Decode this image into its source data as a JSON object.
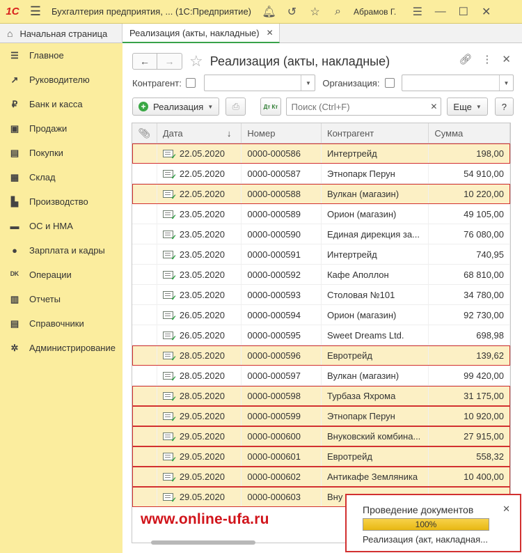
{
  "app": {
    "logo": "1С",
    "title": "Бухгалтерия предприятия, ...  (1С:Предприятие)",
    "user": "Абрамов Г."
  },
  "tabs": {
    "home": "Начальная страница",
    "active": "Реализация (акты, накладные)"
  },
  "sidebar": {
    "items": [
      {
        "label": "Главное",
        "icon": "menu-icon"
      },
      {
        "label": "Руководителю",
        "icon": "chart-line-icon"
      },
      {
        "label": "Банк и касса",
        "icon": "ruble-icon"
      },
      {
        "label": "Продажи",
        "icon": "shopping-bag-icon"
      },
      {
        "label": "Покупки",
        "icon": "cart-icon"
      },
      {
        "label": "Склад",
        "icon": "warehouse-icon"
      },
      {
        "label": "Производство",
        "icon": "factory-icon"
      },
      {
        "label": "ОС и НМА",
        "icon": "truck-icon"
      },
      {
        "label": "Зарплата и кадры",
        "icon": "person-icon"
      },
      {
        "label": "Операции",
        "icon": "dt-kt-icon"
      },
      {
        "label": "Отчеты",
        "icon": "bar-chart-icon"
      },
      {
        "label": "Справочники",
        "icon": "books-icon"
      },
      {
        "label": "Администрирование",
        "icon": "gear-icon"
      }
    ]
  },
  "form": {
    "title": "Реализация (акты, накладные)",
    "filter": {
      "counterparty_label": "Контрагент:",
      "organization_label": "Организация:"
    },
    "toolbar": {
      "create_label": "Реализация",
      "dtkt_label": "Дт Кт",
      "search_placeholder": "Поиск (Ctrl+F)",
      "more_label": "Еще",
      "help_label": "?"
    },
    "columns": [
      "Дата",
      "Номер",
      "Контрагент",
      "Сумма"
    ],
    "rows": [
      {
        "date": "22.05.2020",
        "number": "0000-000586",
        "counterparty": "Интертрейд",
        "sum": "198,00",
        "highlight": true
      },
      {
        "date": "22.05.2020",
        "number": "0000-000587",
        "counterparty": "Этнопарк Перун",
        "sum": "54 910,00",
        "highlight": false
      },
      {
        "date": "22.05.2020",
        "number": "0000-000588",
        "counterparty": "Вулкан (магазин)",
        "sum": "10 220,00",
        "highlight": true
      },
      {
        "date": "23.05.2020",
        "number": "0000-000589",
        "counterparty": "Орион (магазин)",
        "sum": "49 105,00",
        "highlight": false
      },
      {
        "date": "23.05.2020",
        "number": "0000-000590",
        "counterparty": "Единая дирекция за...",
        "sum": "76 080,00",
        "highlight": false
      },
      {
        "date": "23.05.2020",
        "number": "0000-000591",
        "counterparty": "Интертрейд",
        "sum": "740,95",
        "highlight": false
      },
      {
        "date": "23.05.2020",
        "number": "0000-000592",
        "counterparty": "Кафе Аполлон",
        "sum": "68 810,00",
        "highlight": false
      },
      {
        "date": "23.05.2020",
        "number": "0000-000593",
        "counterparty": "Столовая №101",
        "sum": "34 780,00",
        "highlight": false
      },
      {
        "date": "26.05.2020",
        "number": "0000-000594",
        "counterparty": "Орион (магазин)",
        "sum": "92 730,00",
        "highlight": false
      },
      {
        "date": "26.05.2020",
        "number": "0000-000595",
        "counterparty": "Sweet Dreams Ltd.",
        "sum": "698,98",
        "highlight": false
      },
      {
        "date": "28.05.2020",
        "number": "0000-000596",
        "counterparty": "Евротрейд",
        "sum": "139,62",
        "highlight": true
      },
      {
        "date": "28.05.2020",
        "number": "0000-000597",
        "counterparty": "Вулкан (магазин)",
        "sum": "99 420,00",
        "highlight": false
      },
      {
        "date": "28.05.2020",
        "number": "0000-000598",
        "counterparty": "Турбаза Яхрома",
        "sum": "31 175,00",
        "highlight": true
      },
      {
        "date": "29.05.2020",
        "number": "0000-000599",
        "counterparty": "Этнопарк Перун",
        "sum": "10 920,00",
        "highlight": true
      },
      {
        "date": "29.05.2020",
        "number": "0000-000600",
        "counterparty": "Внуковский комбина...",
        "sum": "27 915,00",
        "highlight": true
      },
      {
        "date": "29.05.2020",
        "number": "0000-000601",
        "counterparty": "Евротрейд",
        "sum": "558,32",
        "highlight": true
      },
      {
        "date": "29.05.2020",
        "number": "0000-000602",
        "counterparty": "Антикафе Земляника",
        "sum": "10 400,00",
        "highlight": true
      },
      {
        "date": "29.05.2020",
        "number": "0000-000603",
        "counterparty": "Вну",
        "sum": "",
        "highlight": true
      }
    ]
  },
  "watermark": "www.online-ufa.ru",
  "notification": {
    "title": "Проведение документов",
    "progress": 100,
    "progress_text": "100%",
    "description": "Реализация (акт, накладная..."
  },
  "colors": {
    "accent_green": "#3aa845",
    "highlight_bg": "#fcf0c5",
    "highlight_border": "#d23030",
    "sidebar_bg": "#fbed9e"
  }
}
